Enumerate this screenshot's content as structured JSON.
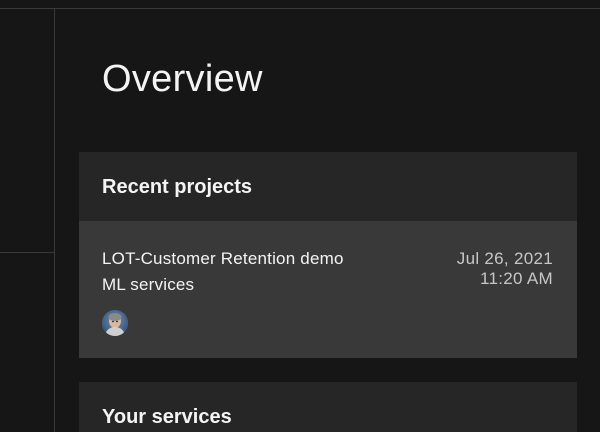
{
  "page": {
    "title": "Overview"
  },
  "recent_projects": {
    "header": "Recent projects",
    "items": [
      {
        "name": "LOT-Customer Retention demo",
        "type": "ML services",
        "date": "Jul 26, 2021",
        "time": "11:20 AM",
        "avatar_icon": "user-avatar-icon"
      }
    ]
  },
  "your_services": {
    "header": "Your services"
  },
  "colors": {
    "background": "#161616",
    "card": "#262626",
    "tile": "#393939",
    "text_primary": "#f4f4f4",
    "text_secondary": "#c6c6c6"
  }
}
